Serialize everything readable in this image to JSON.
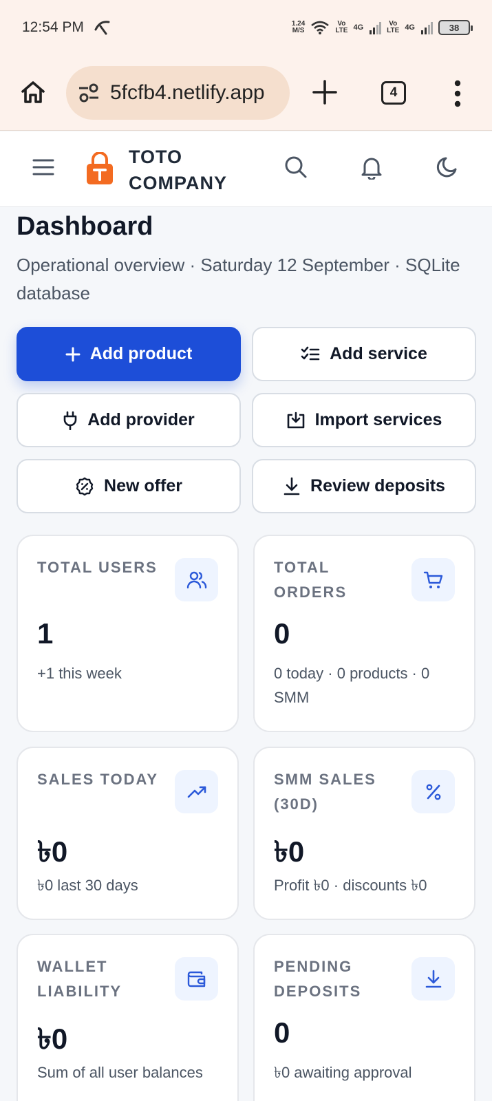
{
  "status_bar": {
    "time": "12:54 PM",
    "speed_value": "1.24",
    "speed_unit": "M/S",
    "sim1_top": "Vo",
    "sim1_bottom": "LTE",
    "sim1_net": "4G",
    "sim2_top": "Vo",
    "sim2_bottom": "LTE",
    "sim2_net": "4G",
    "battery": "38"
  },
  "browser": {
    "url": "5fcfb4.netlify.app",
    "tab_count": "4"
  },
  "header": {
    "brand_line1": "TOTO",
    "brand_line2": "COMPANY"
  },
  "page": {
    "title": "Dashboard",
    "subtitle": "Operational overview · Saturday 12 September · SQLite database"
  },
  "actions": {
    "add_product": "Add product",
    "add_service": "Add service",
    "add_provider": "Add provider",
    "import_services": "Import services",
    "new_offer": "New offer",
    "review_deposits": "Review deposits"
  },
  "stats": [
    {
      "label": "Total users",
      "value": "1",
      "note": "+1 this week"
    },
    {
      "label": "Total orders",
      "value": "0",
      "note": "0 today · 0 products · 0 SMM"
    },
    {
      "label": "Sales today",
      "value": "৳0",
      "note": "৳0 last 30 days"
    },
    {
      "label": "SMM sales (30D)",
      "value": "৳0",
      "note": "Profit ৳0 · discounts ৳0"
    },
    {
      "label": "Wallet liability",
      "value": "৳0",
      "note": "Sum of all user balances"
    },
    {
      "label": "Pending deposits",
      "value": "0",
      "note": "৳0 awaiting approval"
    }
  ],
  "colors": {
    "primary": "#1d4ed8",
    "icon_blue": "#2b59d9",
    "brand_orange": "#f36b21",
    "chrome_bg": "#fdf2ec"
  }
}
